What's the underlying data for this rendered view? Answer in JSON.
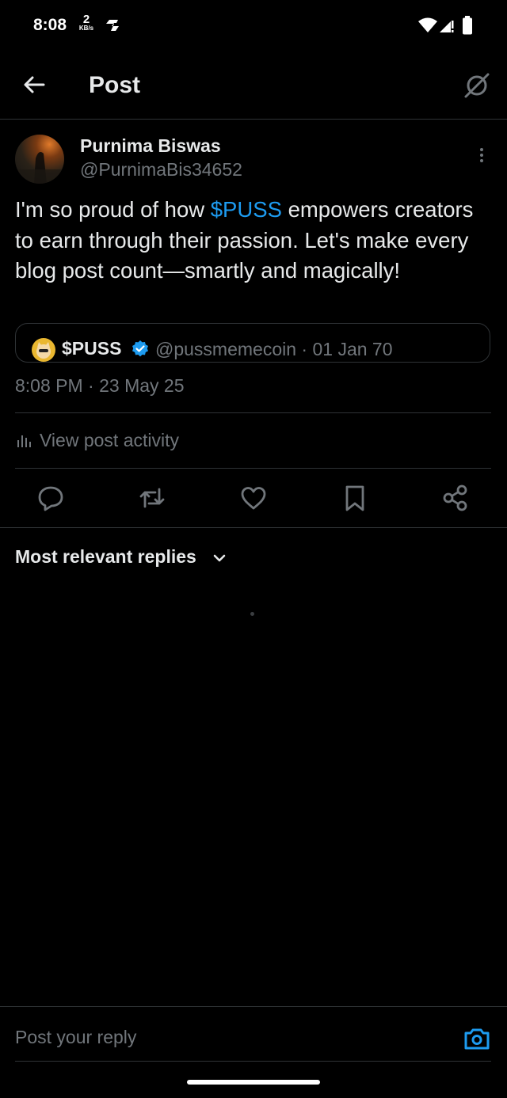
{
  "status_bar": {
    "time": "8:08",
    "network_speed_value": "2",
    "network_speed_unit": "KB/s",
    "icons": [
      "s-app-icon",
      "wifi-icon",
      "cellular-signal-icon",
      "battery-icon"
    ]
  },
  "app_bar": {
    "back_icon": "arrow-left-icon",
    "title": "Post",
    "right_icon": "circle-slash-icon"
  },
  "post": {
    "author_name": "Purnima Biswas",
    "author_handle": "@PurnimaBis34652",
    "text_before": "I'm so proud of how ",
    "cashtag": "$PUSS",
    "text_after": " empowers creators to earn through their passion. Let's make every blog post count—smartly and magically!",
    "quoted": {
      "name": "$PUSS",
      "handle_date": "@pussmemecoin · 01 Jan 70"
    },
    "timestamp": "8:08 PM · 23 May 25",
    "view_activity": "View post activity"
  },
  "actions": [
    "reply-icon",
    "repost-icon",
    "like-icon",
    "bookmark-icon",
    "share-icon"
  ],
  "replies": {
    "sort_label": "Most relevant replies"
  },
  "reply_bar": {
    "placeholder": "Post your reply"
  },
  "colors": {
    "background": "#000000",
    "text": "#e7e9ea",
    "secondary": "#71767b",
    "accent": "#1d9bf0",
    "divider": "#2f3336"
  }
}
